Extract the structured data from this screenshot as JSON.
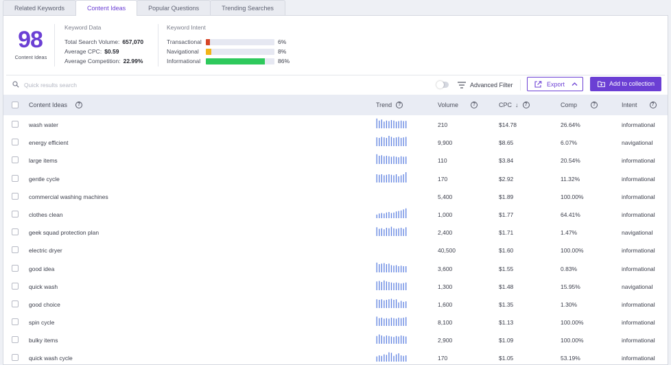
{
  "tabs": [
    "Related Keywords",
    "Content Ideas",
    "Popular Questions",
    "Trending Searches"
  ],
  "active_tab": 1,
  "summary": {
    "count": "98",
    "count_label": "Content Ideas",
    "keyword_data": {
      "title": "Keyword Data",
      "total_volume_label": "Total Search Volume:",
      "total_volume": "657,070",
      "avg_cpc_label": "Average CPC:",
      "avg_cpc": "$0.59",
      "avg_comp_label": "Average Competition:",
      "avg_comp": "22.99%"
    },
    "keyword_intent": {
      "title": "Keyword Intent",
      "items": [
        {
          "label": "Transactional",
          "pct": "6%",
          "fraction": 0.06,
          "color": "#d64527"
        },
        {
          "label": "Navigational",
          "pct": "8%",
          "fraction": 0.08,
          "color": "#f2b418"
        },
        {
          "label": "Informational",
          "pct": "86%",
          "fraction": 0.86,
          "color": "#2ec95c"
        }
      ]
    }
  },
  "toolbar": {
    "search_placeholder": "Quick results search",
    "advanced_filter": "Advanced Filter",
    "export": "Export",
    "add_collection": "Add to collection"
  },
  "columns": {
    "keyword": "Content Ideas",
    "trend": "Trend",
    "volume": "Volume",
    "cpc": "CPC",
    "comp": "Comp",
    "intent": "Intent"
  },
  "colors": {
    "accent": "#6b3fd4",
    "trend_bar": "#5b7fe0"
  },
  "rows": [
    {
      "keyword": "wash water",
      "volume": "210",
      "cpc": "$14.78",
      "comp": "26.64%",
      "intent": "informational",
      "trend": [
        0.95,
        0.75,
        0.85,
        0.65,
        0.75,
        0.7,
        0.8,
        0.75,
        0.65,
        0.7,
        0.75,
        0.7,
        0.72
      ]
    },
    {
      "keyword": "energy efficient",
      "volume": "9,900",
      "cpc": "$8.65",
      "comp": "6.07%",
      "intent": "navigational",
      "trend": [
        0.85,
        0.8,
        0.9,
        0.85,
        0.8,
        1.0,
        0.9,
        0.8,
        0.85,
        0.9,
        0.8,
        0.85,
        0.9
      ]
    },
    {
      "keyword": "large items",
      "volume": "110",
      "cpc": "$3.84",
      "comp": "20.54%",
      "intent": "informational",
      "trend": [
        0.95,
        0.8,
        0.85,
        0.75,
        0.8,
        0.75,
        0.7,
        0.75,
        0.7,
        0.65,
        0.75,
        0.7,
        0.72
      ]
    },
    {
      "keyword": "gentle cycle",
      "volume": "170",
      "cpc": "$2.92",
      "comp": "11.32%",
      "intent": "informational",
      "trend": [
        0.8,
        0.75,
        0.8,
        0.7,
        0.75,
        0.8,
        0.75,
        0.7,
        0.8,
        0.6,
        0.7,
        0.8,
        1.0
      ]
    },
    {
      "keyword": "commercial washing machines",
      "volume": "5,400",
      "cpc": "$1.89",
      "comp": "100.00%",
      "intent": "informational",
      "trend": []
    },
    {
      "keyword": "clothes clean",
      "volume": "1,000",
      "cpc": "$1.77",
      "comp": "64.41%",
      "intent": "informational",
      "trend": [
        0.35,
        0.45,
        0.5,
        0.45,
        0.55,
        0.6,
        0.5,
        0.55,
        0.65,
        0.7,
        0.75,
        0.85,
        0.95
      ]
    },
    {
      "keyword": "geek squad protection plan",
      "volume": "2,400",
      "cpc": "$1.71",
      "comp": "1.47%",
      "intent": "navigational",
      "trend": [
        0.85,
        0.7,
        0.75,
        0.65,
        0.8,
        0.75,
        0.9,
        0.75,
        0.7,
        0.75,
        0.8,
        0.7,
        0.85
      ]
    },
    {
      "keyword": "electric dryer",
      "volume": "40,500",
      "cpc": "$1.60",
      "comp": "100.00%",
      "intent": "informational",
      "trend": []
    },
    {
      "keyword": "good idea",
      "volume": "3,600",
      "cpc": "$1.55",
      "comp": "0.83%",
      "intent": "informational",
      "trend": [
        0.95,
        0.8,
        0.85,
        0.9,
        0.8,
        0.85,
        0.7,
        0.65,
        0.7,
        0.6,
        0.65,
        0.6,
        0.6
      ]
    },
    {
      "keyword": "quick wash",
      "volume": "1,300",
      "cpc": "$1.48",
      "comp": "15.95%",
      "intent": "navigational",
      "trend": [
        0.85,
        0.9,
        0.8,
        0.95,
        0.85,
        0.8,
        0.75,
        0.7,
        0.75,
        0.7,
        0.65,
        0.7,
        0.75
      ]
    },
    {
      "keyword": "good choice",
      "volume": "1,600",
      "cpc": "$1.35",
      "comp": "1.30%",
      "intent": "informational",
      "trend": [
        0.85,
        0.8,
        0.85,
        0.75,
        0.8,
        0.85,
        0.9,
        0.8,
        0.85,
        0.55,
        0.7,
        0.6,
        0.65
      ]
    },
    {
      "keyword": "spin cycle",
      "volume": "8,100",
      "cpc": "$1.13",
      "comp": "100.00%",
      "intent": "informational",
      "trend": [
        0.9,
        0.75,
        0.8,
        0.7,
        0.75,
        0.7,
        0.8,
        0.75,
        0.7,
        0.8,
        0.75,
        0.8,
        0.85
      ]
    },
    {
      "keyword": "bulky items",
      "volume": "2,900",
      "cpc": "$1.09",
      "comp": "100.00%",
      "intent": "informational",
      "trend": [
        0.75,
        0.9,
        0.8,
        0.7,
        0.8,
        0.75,
        0.7,
        0.65,
        0.75,
        0.7,
        0.8,
        0.75,
        0.7
      ]
    },
    {
      "keyword": "quick wash cycle",
      "volume": "170",
      "cpc": "$1.05",
      "comp": "53.19%",
      "intent": "informational",
      "trend": [
        0.5,
        0.6,
        0.55,
        0.7,
        0.65,
        0.9,
        0.85,
        0.55,
        0.7,
        0.8,
        0.6,
        0.55,
        0.6
      ]
    }
  ]
}
